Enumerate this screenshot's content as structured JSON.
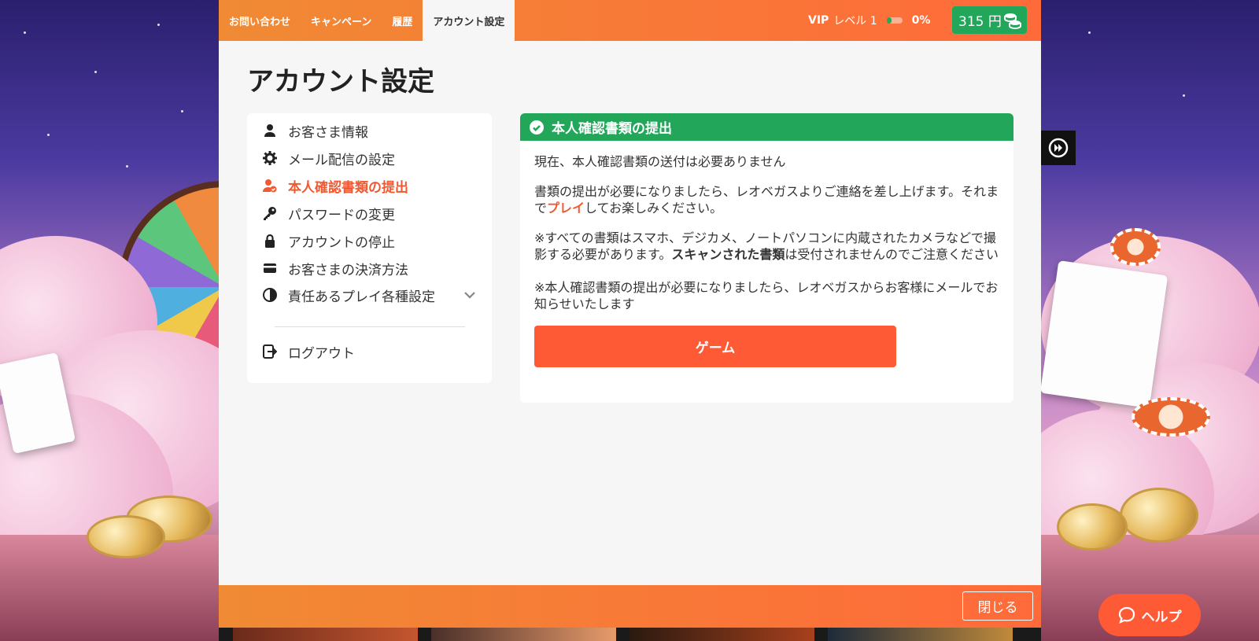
{
  "colors": {
    "accent_orange": "#ff5a36",
    "header_orange": "#f08a34",
    "success_green": "#21a65a",
    "text_dark": "#222222"
  },
  "topnav": {
    "tabs": [
      {
        "label": "お問い合わせ"
      },
      {
        "label": "キャンペーン"
      },
      {
        "label": "履歴"
      },
      {
        "label": "アカウント設定",
        "active": true
      }
    ],
    "vip": {
      "prefix": "VIP",
      "level_label": "レベル 1",
      "progress_label": "0%",
      "progress": 0.3
    },
    "balance": {
      "amount": "315 円",
      "icon": "coins-stack-icon"
    }
  },
  "page": {
    "title": "アカウント設定"
  },
  "sidebar": {
    "items": [
      {
        "label": "お客さま情報",
        "icon": "user-icon"
      },
      {
        "label": "メール配信の設定",
        "icon": "gear-icon"
      },
      {
        "label": "本人確認書類の提出",
        "icon": "user-check-icon",
        "active": true
      },
      {
        "label": "パスワードの変更",
        "icon": "key-icon"
      },
      {
        "label": "アカウントの停止",
        "icon": "lock-icon"
      },
      {
        "label": "お客さまの決済方法",
        "icon": "credit-card-icon"
      },
      {
        "label": "責任あるプレイ各種設定",
        "icon": "half-circle-icon",
        "expandable": true
      }
    ],
    "logout_label": "ログアウト"
  },
  "verification": {
    "header": "本人確認書類の提出",
    "status_text": "現在、本人確認書類の送付は必要ありません",
    "para2_before": "書類の提出が必要になりましたら、レオベガスよりご連絡を差し上げます。それまで",
    "para2_link": "プレイ",
    "para2_after": "してお楽しみください。",
    "para3_before": "※すべての書類はスマホ、デジカメ、ノートパソコンに内蔵されたカメラなどで撮影する必要があります。",
    "para3_bold": "スキャンされた書類",
    "para3_after": "は受付されませんのでご注意ください",
    "para4": "※本人確認書類の提出が必要になりましたら、レオベガスからお客様にメールでお知らせいたします",
    "game_button": "ゲーム"
  },
  "footer": {
    "close_label": "閉じる"
  },
  "help": {
    "label": "ヘルプ"
  }
}
